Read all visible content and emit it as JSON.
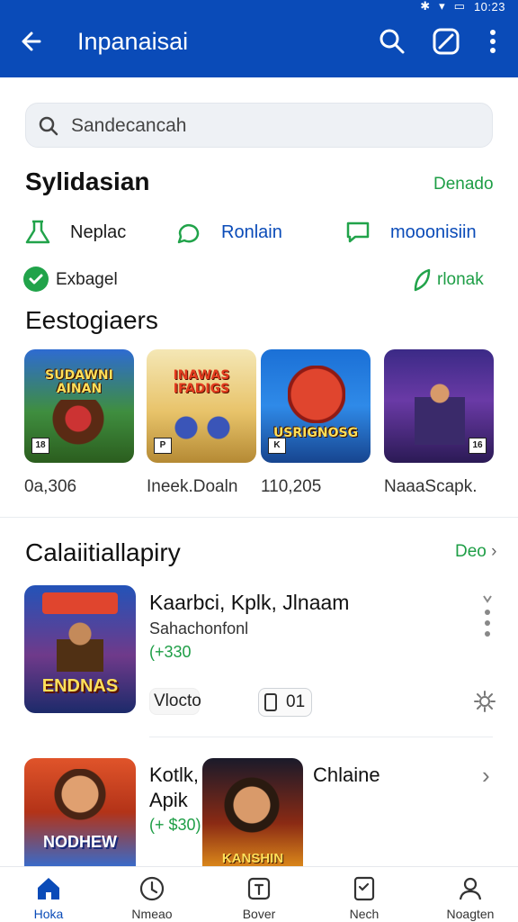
{
  "colors": {
    "primary": "#0a4bb8",
    "green": "#1e9e46",
    "text": "#111111"
  },
  "appbar": {
    "title": "Inpanaisai",
    "time": "10:23"
  },
  "search": {
    "placeholder": "Sandecancah"
  },
  "section1": {
    "title": "Sylidasian",
    "action": "Denado",
    "categories": [
      {
        "icon": "flask-icon",
        "label": "Neplac"
      },
      {
        "icon": "chat-bubble-icon",
        "label": "Ronlain"
      },
      {
        "icon": "message-icon",
        "label": "mooonisiin"
      }
    ],
    "check_label": "Exbagel",
    "tag_label": "rlonak"
  },
  "section2": {
    "title": "Eestogiaers",
    "tiles": [
      {
        "art": "SUDAWNI AINAN",
        "caption": "0a,306"
      },
      {
        "art": "INAWAS IFADIGS",
        "caption": "Ineek.Doaln"
      },
      {
        "art": "USRIGNOSG",
        "caption": "110,205"
      },
      {
        "art": "",
        "caption": "NaaaScapk."
      }
    ]
  },
  "section3": {
    "title": "Calaiitiallapiry",
    "action": "Deo",
    "items": [
      {
        "art": "ENDNAS",
        "title": "Kaarbci, Kplk, Jlnaam",
        "subtitle": "Sahachonfonl",
        "price": "(+330",
        "btn1": "Vlocto",
        "btn2": "01"
      },
      {
        "art": "NODHEW",
        "title": "Kotlk,",
        "title2": "Apik",
        "price": "(+ $30)",
        "art2": "KANSHIN",
        "side": "Chlaine"
      }
    ]
  },
  "bottom_nav": [
    {
      "icon": "home-icon",
      "label": "Hoka"
    },
    {
      "icon": "history-icon",
      "label": "Nmeao"
    },
    {
      "icon": "box-icon",
      "label": "Bover"
    },
    {
      "icon": "notes-icon",
      "label": "Nech"
    },
    {
      "icon": "person-icon",
      "label": "Noagten"
    }
  ]
}
